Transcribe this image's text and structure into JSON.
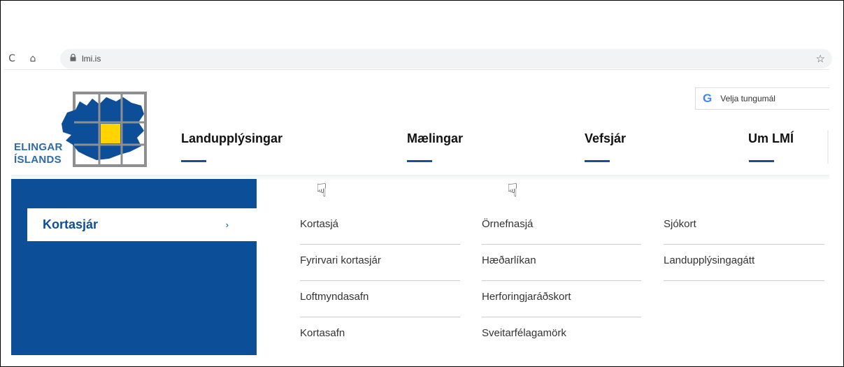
{
  "browser": {
    "reload_icon": "C",
    "home_icon": "⌂",
    "lock_icon": "lock-icon",
    "url": "lmi.is",
    "bookmark_icon": "☆"
  },
  "logo": {
    "line1": "ELINGAR",
    "line2": "ÍSLANDS"
  },
  "language": {
    "g": "G",
    "label": "Velja tungumál"
  },
  "nav": {
    "items": [
      "Landupplýsingar",
      "Mælingar",
      "Vefsjár",
      "Um LMÍ"
    ]
  },
  "dropdown": {
    "active_label": "Kortasjár",
    "chevron": "›",
    "hand_icon": "☟",
    "columns": [
      [
        "Kortasjá",
        "Fyrirvari kortasjár",
        "Loftmyndasafn",
        "Kortasafn"
      ],
      [
        "Örnefnasjá",
        "Hæðarlíkan",
        "Herforingjaráðskort",
        "Sveitarfélagamörk"
      ],
      [
        "Sjókort",
        "Landupplýsingagátt"
      ]
    ]
  },
  "colors": {
    "brand_blue": "#0c4f98",
    "logo_yellow": "#ffd400",
    "logo_gray": "#8f8f8f"
  }
}
